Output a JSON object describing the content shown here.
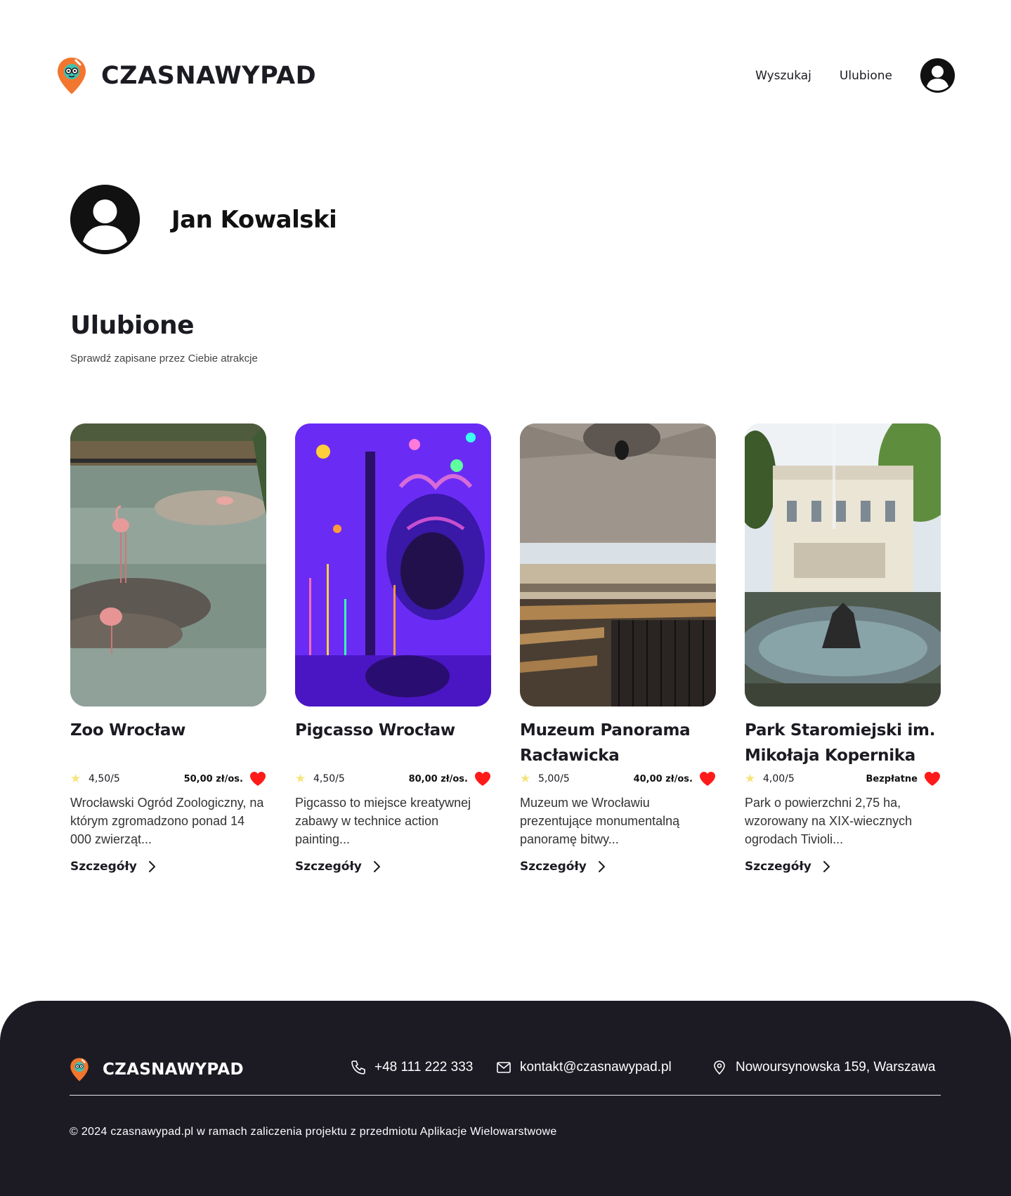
{
  "header": {
    "brand": "CZASNAWYPAD",
    "nav": {
      "search": "Wyszukaj",
      "favorites": "Ulubione"
    },
    "account_icon": "user-circle-icon"
  },
  "profile": {
    "name": "Jan Kowalski",
    "avatar_icon": "user-circle-icon"
  },
  "favorites": {
    "title": "Ulubione",
    "subtitle": "Sprawdź zapisane przez Ciebie atrakcje",
    "cards": [
      {
        "title": "Zoo Wrocław",
        "rating": "4,50/5",
        "price": "50,00 zł/os.",
        "description": "Wrocławski Ogród Zoologiczny, na którym zgromadzono ponad 14 000 zwierząt...",
        "details": "Szczegóły"
      },
      {
        "title": "Pigcasso Wrocław",
        "rating": "4,50/5",
        "price": "80,00 zł/os.",
        "description": "Pigcasso to miejsce kreatywnej zabawy w technice action painting...",
        "details": "Szczegóły"
      },
      {
        "title": "Muzeum Panorama Racławicka",
        "rating": "5,00/5",
        "price": "40,00 zł/os.",
        "description": "Muzeum we Wrocławiu prezentujące monumentalną panoramę bitwy...",
        "details": "Szczegóły"
      },
      {
        "title": "Park Staromiejski im. Mikołaja Kopernika",
        "rating": "4,00/5",
        "price": "Bezpłatne",
        "description": "Park o powierzchni 2,75 ha, wzorowany na XIX-wiecznych ogrodach Tivioli...",
        "details": "Szczegóły"
      }
    ]
  },
  "footer": {
    "brand": "CZASNAWYPAD",
    "phone": "+48 111 222 333",
    "email": "kontakt@czasnawypad.pl",
    "address": "Nowoursynowska 159, Warszawa",
    "copyright": "© 2024 czasnawypad.pl w ramach zaliczenia projektu z przedmiotu Aplikacje Wielowarstwowe"
  },
  "colors": {
    "brand_orange": "#f2762e",
    "brand_teal": "#3fc2b2",
    "footer_bg": "#1c1b24",
    "heart_red": "#ff1a1a",
    "star_yellow": "#f7e37a"
  }
}
